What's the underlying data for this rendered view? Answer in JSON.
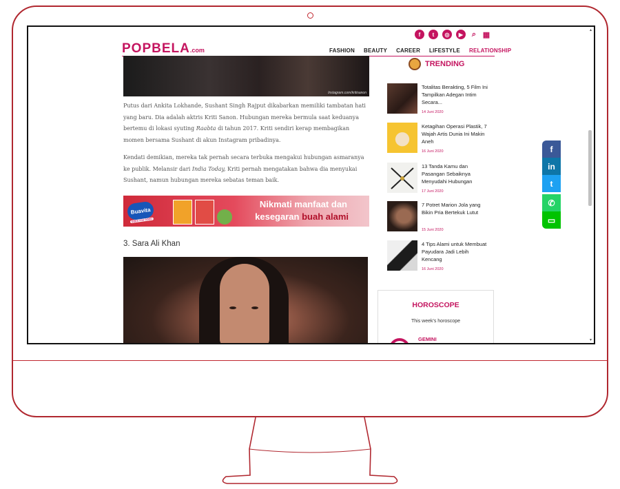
{
  "site": {
    "logo_main": "POPBELA",
    "logo_suffix": ".com"
  },
  "header": {
    "social_icons": [
      "facebook-icon",
      "twitter-icon",
      "instagram-icon",
      "youtube-icon",
      "search-icon",
      "grid-menu-icon"
    ],
    "nav": [
      "FASHION",
      "BEAUTY",
      "CAREER",
      "LIFESTYLE",
      "RELATIONSHIP"
    ],
    "active_nav": "RELATIONSHIP"
  },
  "article": {
    "image_credit": "Instagram.com/kritisanon",
    "paragraph1_part1": "Putus dari Ankita Lokhande, Sushant Singh Rajput dikabarkan memiliki tambatan hati yang baru. Dia adalah aktris Kriti Sanon. Hubungan mereka bermula saat keduanya bertemu di lokasi syuting ",
    "paragraph1_italic": "Raabta",
    "paragraph1_part2": " di tahun 2017. Kriti sendiri kerap membagikan momen bersama Sushant di akun Instagram pribadinya.",
    "paragraph2_part1": "Kendati demikian, mereka tak pernah secara terbuka mengakui hubungan asmaranya ke publik. Melansir dari ",
    "paragraph2_italic": "India Today,",
    "paragraph2_part2": " Kriti pernah mengatakan bahwa dia menyukai Sushant, namun hubungan mereka sebatas teman baik.",
    "ad_brand": "Buavita",
    "ad_tagline": "DOES YOU GOOD",
    "ad_text_line1": "Nikmati manfaat dan",
    "ad_text_line2_a": "kesegaran ",
    "ad_text_line2_b": "buah alami",
    "subheading": "3. Sara Ali Khan"
  },
  "trending": {
    "title": "TRENDING",
    "items": [
      {
        "title": "Totalitas Berakting, 5 Film Ini Tampilkan Adegan Intim Secara...",
        "date": "14 Juni 2020"
      },
      {
        "title": "Ketagihan Operasi Plastik, 7 Wajah Artis Dunia Ini Makin Aneh",
        "date": "16 Juni 2020"
      },
      {
        "title": "13 Tanda Kamu dan Pasangan Sebaiknya Menyudahi Hubungan",
        "date": "17 Juni 2020"
      },
      {
        "title": "7 Potret Marion Jola yang Bikin Pria Bertekuk Lutut",
        "date": "15 Juni 2020"
      },
      {
        "title": "4 Tips Alami untuk Membuat Payudara Jadi Lebih Kencang",
        "date": "16 Juni 2020"
      }
    ]
  },
  "horoscope": {
    "title": "HOROSCOPE",
    "subtitle": "This week's horoscope",
    "sign": "GEMINI"
  },
  "share_bar": [
    "facebook-icon",
    "linkedin-icon",
    "twitter-icon",
    "whatsapp-icon",
    "line-icon"
  ],
  "colors": {
    "brand": "#c4145f",
    "monitor_outline": "#b0272f",
    "facebook": "#3b5998",
    "linkedin": "#0e76a8",
    "twitter": "#1da1f2",
    "whatsapp": "#25d366",
    "line": "#00c300"
  }
}
